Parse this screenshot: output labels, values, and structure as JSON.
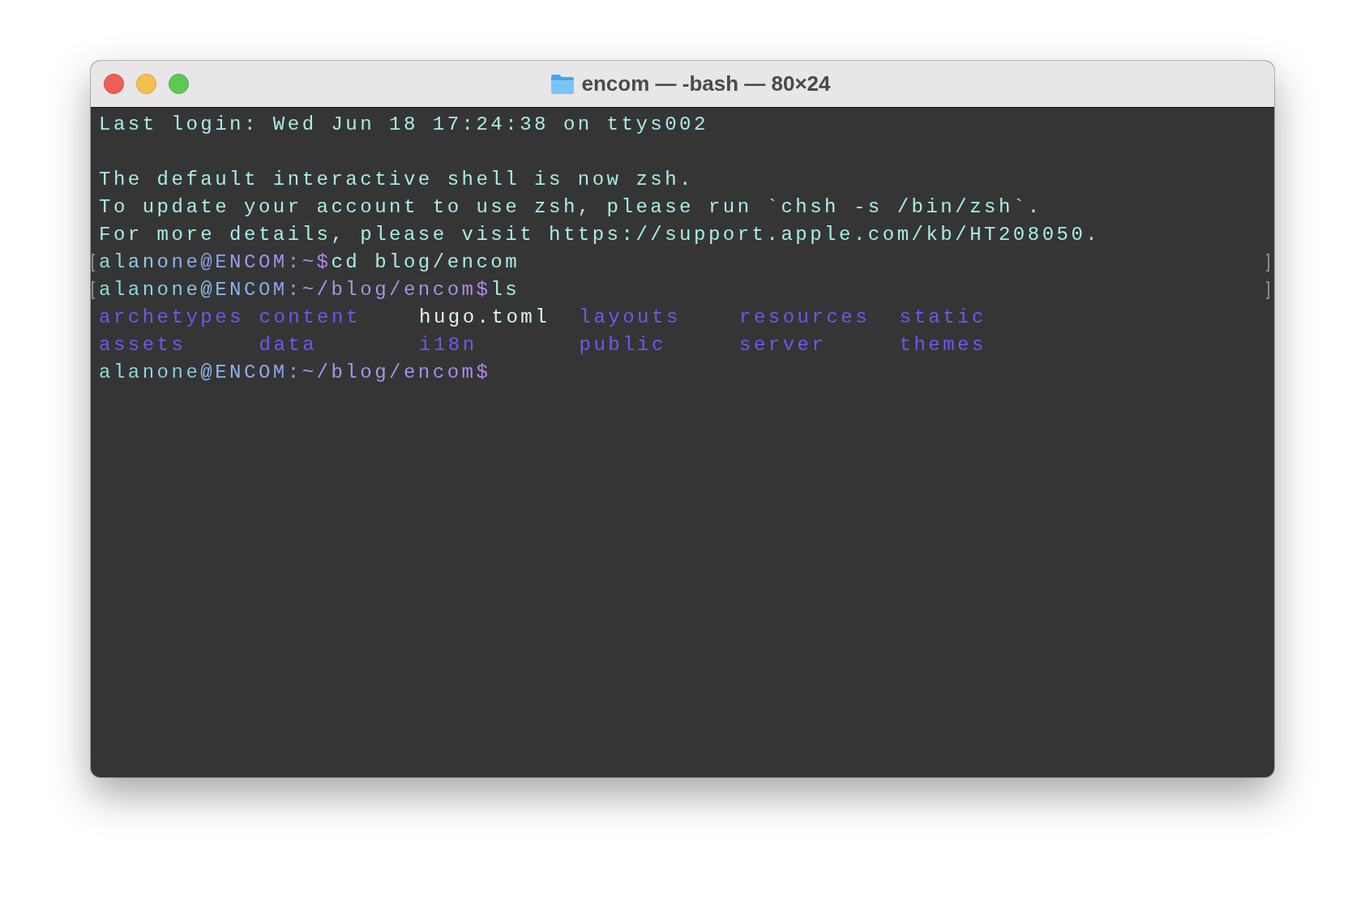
{
  "window": {
    "title": "encom — -bash — 80×24"
  },
  "lines": [
    {
      "kind": "text",
      "text": "Last login: Wed Jun 18 17:24:38 on ttys002"
    },
    {
      "kind": "blank"
    },
    {
      "kind": "text",
      "text": "The default interactive shell is now zsh."
    },
    {
      "kind": "text",
      "text": "To update your account to use zsh, please run `chsh -s /bin/zsh`."
    },
    {
      "kind": "text",
      "text": "For more details, please visit https://support.apple.com/kb/HT208050."
    },
    {
      "kind": "command",
      "prompt": "alanone@ENCOM:~$",
      "command": "cd blog/encom",
      "marked": true
    },
    {
      "kind": "command",
      "prompt": "alanone@ENCOM:~/blog/encom$",
      "command": "ls",
      "marked": true
    },
    {
      "kind": "listing",
      "entries": [
        {
          "name": "archetypes",
          "kind": "dir"
        },
        {
          "name": "content",
          "kind": "dir"
        },
        {
          "name": "hugo.toml",
          "kind": "file"
        },
        {
          "name": "layouts",
          "kind": "dir"
        },
        {
          "name": "resources",
          "kind": "dir"
        },
        {
          "name": "static",
          "kind": "dir"
        }
      ]
    },
    {
      "kind": "listing",
      "entries": [
        {
          "name": "assets",
          "kind": "dir"
        },
        {
          "name": "data",
          "kind": "dir"
        },
        {
          "name": "i18n",
          "kind": "dir"
        },
        {
          "name": "public",
          "kind": "dir"
        },
        {
          "name": "server",
          "kind": "dir"
        },
        {
          "name": "themes",
          "kind": "dir"
        }
      ]
    },
    {
      "kind": "command",
      "prompt": "alanone@ENCOM:~/blog/encom$",
      "marked": false
    }
  ]
}
